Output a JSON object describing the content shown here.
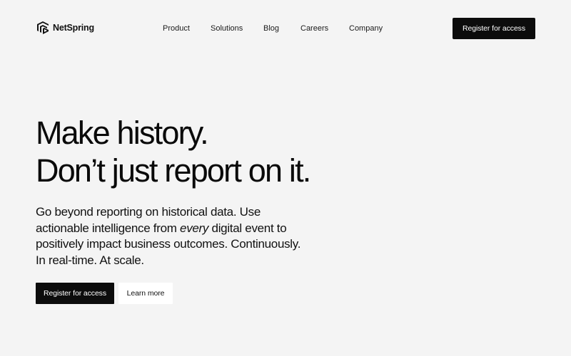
{
  "brand": {
    "logo_icon": "netspring-logo-icon",
    "name": "NetSpring"
  },
  "nav": {
    "items": [
      {
        "label": "Product"
      },
      {
        "label": "Solutions"
      },
      {
        "label": "Blog"
      },
      {
        "label": "Careers"
      },
      {
        "label": "Company"
      }
    ]
  },
  "header": {
    "cta_label": "Register for access"
  },
  "hero": {
    "title_line1": "Make history.",
    "title_line2": "Don’t just report on it.",
    "desc_part1": "Go beyond reporting on historical data. Use actionable intelligence from ",
    "desc_emphasis": "every",
    "desc_part2": " digital event to positively impact business outcomes. Continuously. In real-time. At scale.",
    "primary_cta": "Register for access",
    "secondary_cta": "Learn more"
  },
  "colors": {
    "background": "#f4f4f4",
    "button_dark": "#0c0c0c",
    "button_light": "#ffffff",
    "text": "#111111"
  }
}
